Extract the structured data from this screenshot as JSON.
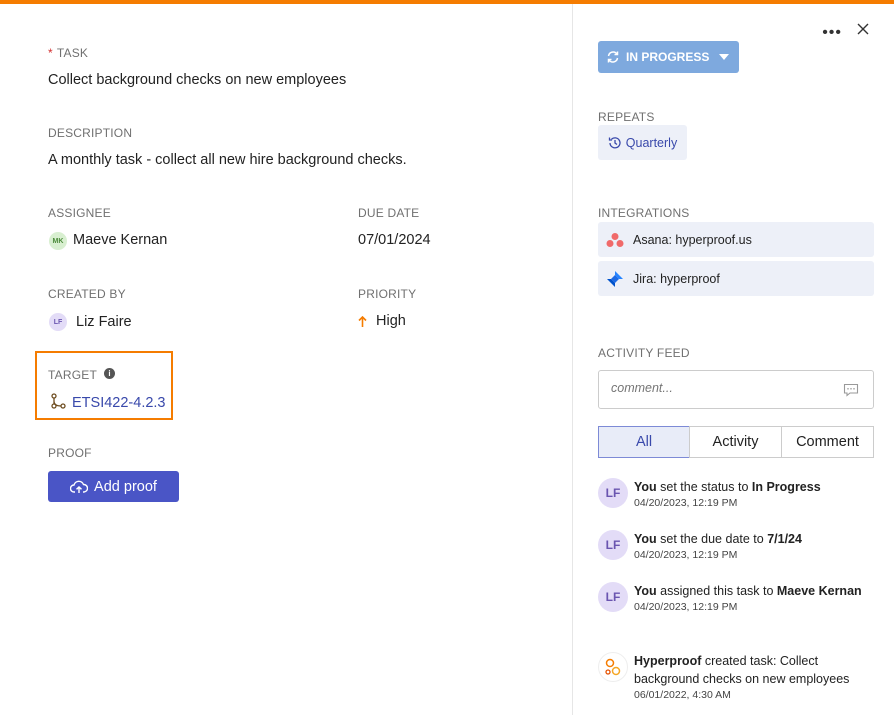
{
  "task": {
    "label": "TASK",
    "required_mark": "*",
    "value": "Collect background checks on new employees"
  },
  "description": {
    "label": "DESCRIPTION",
    "value": "A monthly task - collect all new hire background checks."
  },
  "assignee": {
    "label": "ASSIGNEE",
    "initials": "MK",
    "name": "Maeve Kernan"
  },
  "due_date": {
    "label": "DUE DATE",
    "value": "07/01/2024"
  },
  "created_by": {
    "label": "CREATED BY",
    "initials": "LF",
    "name": "Liz Faire"
  },
  "priority": {
    "label": "PRIORITY",
    "value": "High",
    "icon": "arrow-up-icon"
  },
  "target": {
    "label": "TARGET",
    "info_glyph": "i",
    "value": "ETSI422-4.2.3"
  },
  "proof": {
    "label": "PROOF",
    "button_label": "Add proof"
  },
  "status": {
    "label": "IN PROGRESS"
  },
  "repeats": {
    "label": "REPEATS",
    "value": "Quarterly"
  },
  "integrations": {
    "label": "INTEGRATIONS",
    "items": [
      {
        "name": "Asana: hyperproof.us",
        "icon": "asana-icon"
      },
      {
        "name": "Jira: hyperproof",
        "icon": "jira-icon"
      }
    ]
  },
  "activity": {
    "label": "ACTIVITY FEED",
    "comment_placeholder": "comment...",
    "tabs": [
      {
        "label": "All",
        "active": true
      },
      {
        "label": "Activity"
      },
      {
        "label": "Comment"
      }
    ],
    "items": [
      {
        "initials": "LF",
        "actor": "You",
        "text": " set the status to ",
        "bold_tail": "In Progress",
        "time": "04/20/2023, 12:19 PM"
      },
      {
        "initials": "LF",
        "actor": "You",
        "text": " set the due date to ",
        "bold_tail": "7/1/24",
        "time": "04/20/2023, 12:19 PM"
      },
      {
        "initials": "LF",
        "actor": "You",
        "text": " assigned this task to ",
        "bold_tail": "Maeve Kernan",
        "time": "04/20/2023, 12:19 PM"
      },
      {
        "initials": "",
        "actor": "Hyperproof",
        "text": " created task: Collect background checks on new employees",
        "bold_tail": "",
        "time": "06/01/2022, 4:30 AM"
      }
    ]
  },
  "colors": {
    "accent": "#f57c00",
    "primary": "#4a55c6",
    "status": "#7ea9de",
    "link": "#3949ab"
  }
}
